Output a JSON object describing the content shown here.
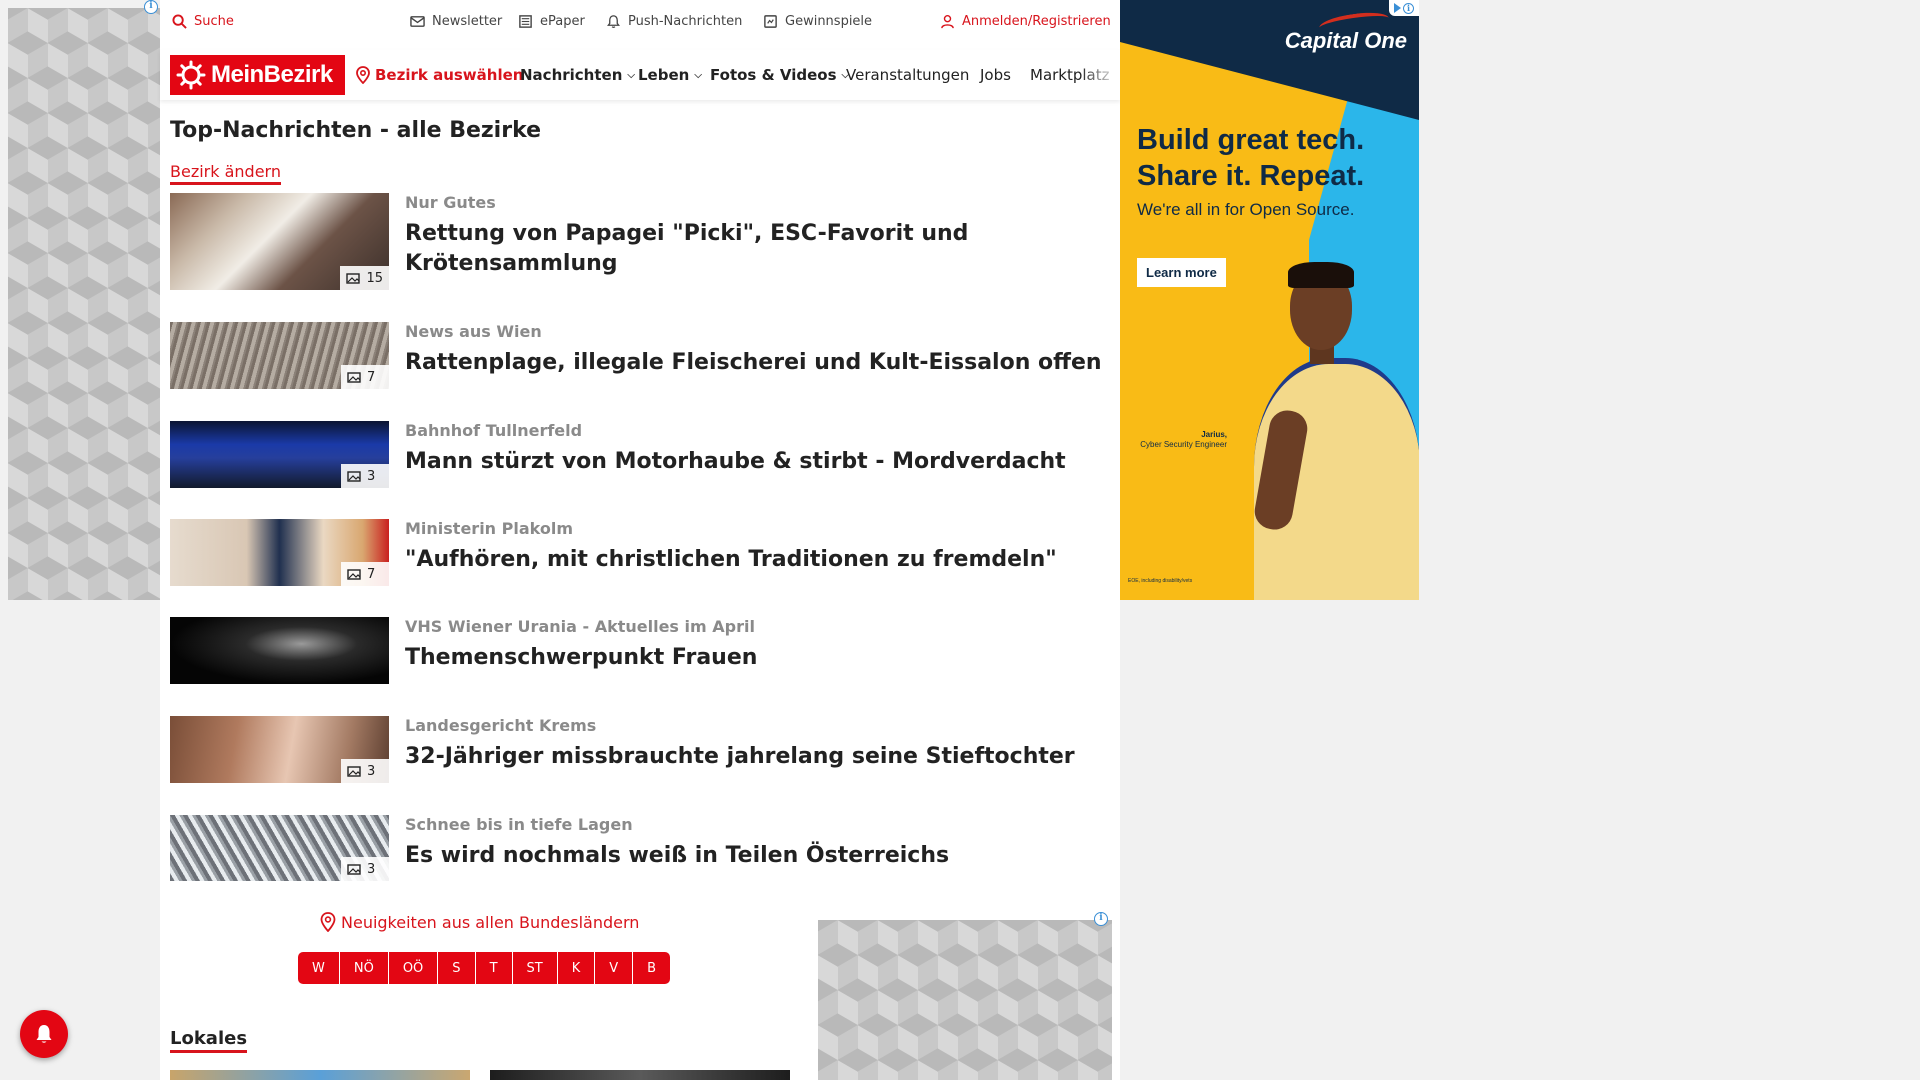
{
  "topbar": {
    "search": "Suche",
    "newsletter": "Newsletter",
    "epaper": "ePaper",
    "push": "Push-Nachrichten",
    "games": "Gewinnspiele",
    "login": "Anmelden/Registrieren"
  },
  "nav": {
    "logo": "MeinBezirk",
    "choose_district": "Bezirk auswählen",
    "items": [
      "Nachrichten",
      "Leben",
      "Fotos & Videos",
      "Veranstaltungen",
      "Jobs",
      "Marktplatz"
    ]
  },
  "page": {
    "title": "Top-Nachrichten - alle Bezirke",
    "change_district": "Bezirk ändern"
  },
  "articles": [
    {
      "kicker": "Nur Gutes",
      "headline": "Rettung von Papagei \"Picki\", ESC-Favorit und Krötensammlung",
      "images": "15"
    },
    {
      "kicker": "News aus Wien",
      "headline": "Rattenplage, illegale Fleischerei und Kult-Eissalon offen",
      "images": "7"
    },
    {
      "kicker": "Bahnhof Tullnerfeld",
      "headline": "Mann stürzt von Motorhaube & stirbt - Mordverdacht",
      "images": "3"
    },
    {
      "kicker": "Ministerin Plakolm",
      "headline": "\"Aufhören, mit christlichen Traditionen zu fremdeln\"",
      "images": "7"
    },
    {
      "kicker": "VHS Wiener Urania - Aktuelles im April",
      "headline": "Themenschwerpunkt Frauen",
      "images": ""
    },
    {
      "kicker": "Landesgericht Krems",
      "headline": "32-Jähriger missbrauchte jahrelang seine Stieftochter",
      "images": "3"
    },
    {
      "kicker": "Schnee bis in tiefe Lagen",
      "headline": "Es wird nochmals weiß in Teilen Österreichs",
      "images": "3"
    }
  ],
  "regions": {
    "link": "Neuigkeiten aus allen Bundesländern",
    "buttons": [
      "W",
      "NÖ",
      "OÖ",
      "S",
      "T",
      "ST",
      "K",
      "V",
      "B"
    ]
  },
  "sections": {
    "local": "Lokales"
  },
  "ad": {
    "brand": "Capital One",
    "headline_1": "Build great tech.",
    "headline_2": "Share it. Repeat.",
    "sub": "We're all in for Open Source.",
    "cta": "Learn more",
    "caption_name": "Jarius,",
    "caption_role": "Cyber Security Engineer",
    "disclaimer": "EOE, including disability/vets"
  },
  "colors": {
    "brand_red": "#e30613",
    "link_red": "#d8141c",
    "ad_yellow": "#f9bb16",
    "ad_navy": "#0f2a46",
    "ad_blue": "#2bb6ea"
  }
}
